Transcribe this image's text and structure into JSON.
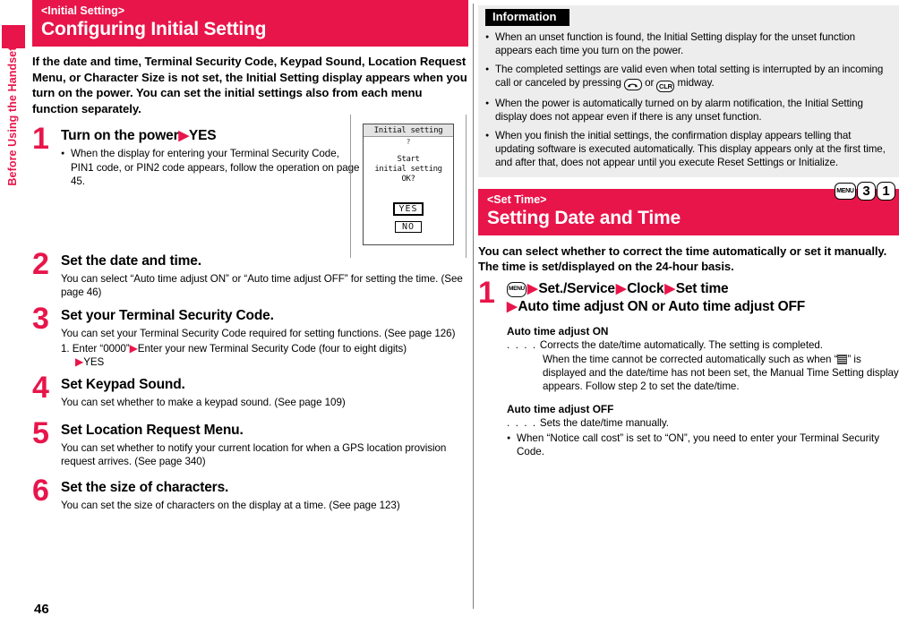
{
  "sidebar": {
    "tab_label": "Before Using the Handset",
    "accent": "#e8154a"
  },
  "page_number": "46",
  "left": {
    "section": {
      "subtitle": "<Initial Setting>",
      "title": "Configuring Initial Setting"
    },
    "lead": "If the date and time, Terminal Security Code, Keypad Sound, Location Request Menu, or Character Size is not set, the Initial Setting display appears when you turn on the power. You can set the initial settings also from each menu function separately.",
    "steps": [
      {
        "num": "1",
        "head_pre": "Turn on the power",
        "head_post": "YES",
        "bullets": [
          "When the display for entering your Terminal Security Code, PIN1 code, or PIN2 code appears, follow the operation on page 45."
        ]
      },
      {
        "num": "2",
        "head": "Set the date and time.",
        "body": "You can select “Auto time adjust ON” or “Auto time adjust OFF” for setting the time. (See page 46)"
      },
      {
        "num": "3",
        "head": "Set your Terminal Security Code.",
        "body": "You can set your Terminal Security Code required for setting functions. (See page 126)",
        "numbered": {
          "index": "1.",
          "part1": "Enter “0000”",
          "part2": "Enter your new Terminal Security Code (four to eight digits)",
          "part3": "YES"
        }
      },
      {
        "num": "4",
        "head": "Set Keypad Sound.",
        "body": "You can set whether to make a keypad sound. (See page 109)"
      },
      {
        "num": "5",
        "head": "Set Location Request Menu.",
        "body": "You can set whether to notify your current location for when a GPS location provision request arrives. (See page 340)"
      },
      {
        "num": "6",
        "head": "Set the size of characters.",
        "body": "You can set the size of characters on the display at a time. (See page 123)"
      }
    ],
    "phone_mock": {
      "title": "Initial setting",
      "question_mark": "?",
      "message_line1": "Start",
      "message_line2": "initial setting",
      "message_line3": "OK?",
      "yes_label": "YES",
      "no_label": "NO"
    }
  },
  "right": {
    "information": {
      "label": "Information",
      "items": [
        {
          "pre": "When an unset function is found, the Initial Setting display for the unset function appears each time you turn on the power.",
          "post": ""
        },
        {
          "pre": "The completed settings are valid even when total setting is interrupted by an incoming call or canceled by pressing ",
          "mid": " or ",
          "post": " midway.",
          "key1": "end-call-key",
          "key2": "CLR"
        },
        {
          "pre": "When the power is automatically turned on by alarm notification, the Initial Setting display does not appear even if there is any unset function.",
          "post": ""
        },
        {
          "pre": "When you finish the initial settings, the confirmation display appears telling that updating software is executed automatically. This display appears only at the first time, and after that, does not appear until you execute Reset Settings or Initialize.",
          "post": ""
        }
      ]
    },
    "section": {
      "subtitle": "<Set Time>",
      "title": "Setting Date and Time",
      "menu_path": {
        "menu_label": "MENU",
        "key1": "3",
        "key2": "1"
      }
    },
    "lead": "You can select whether to correct the time automatically or set it manually. The time is set/displayed on the 24-hour basis.",
    "step": {
      "num": "1",
      "menu_key": "MENU",
      "line1_a": "Set./Service",
      "line1_b": "Clock",
      "line1_c": "Set time",
      "line2": "Auto time adjust ON or Auto time adjust OFF"
    },
    "options": [
      {
        "title": "Auto time adjust ON",
        "dots": ". . . .",
        "body1": "Corrects the date/time automatically. The setting is completed.",
        "body2_pre": "When the time cannot be corrected automatically such as when “",
        "body2_post": "” is displayed and the date/time has not been set, the Manual Time Setting display appears. Follow step 2 to set the date/time.",
        "has_icon": true
      },
      {
        "title": "Auto time adjust OFF",
        "dots": ". . . .",
        "body1": "Sets the date/time manually.",
        "has_icon": false
      }
    ],
    "note": "When “Notice call cost” is set to “ON”, you need to enter your Terminal Security Code."
  }
}
